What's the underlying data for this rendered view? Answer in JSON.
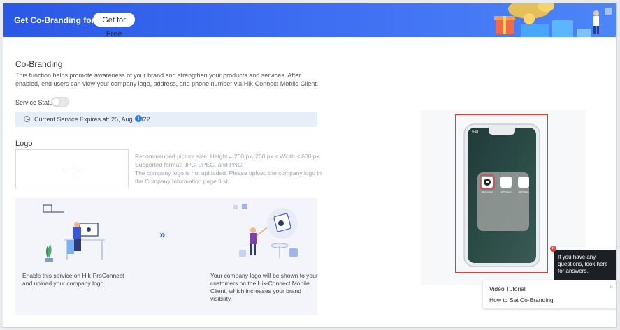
{
  "banner": {
    "title": "Get Co-Branding for Free",
    "button_label": "Get for Free"
  },
  "cobranding": {
    "title": "Co-Branding",
    "description": "This function helps promote awareness of your brand and strengthen your products and services. After enabled, end users can view your company logo, address, and phone number via Hik-Connect Mobile Client.",
    "service_status_label": "Service Status:",
    "service_enabled": false,
    "expire_text": "Current Service Expires at: 25, Aug. 2022"
  },
  "logo": {
    "title": "Logo",
    "hint_line1": "Recommended picture size: Height = 200 px, 200 px ≤ Width ≤ 600 px.",
    "hint_line2": "Supported format: JPG, JPEG, and PNG.",
    "hint_line3": "The company logo is not uploaded. Please upload the company logo in the Company Information page first."
  },
  "promo": {
    "left_text": "Enable this service on Hik-ProConnect and upload your company logo.",
    "right_text": "Your company logo will be shown to your customers on the Hik-Connect Mobile Client, which increases your brand visibility.",
    "arrows": "»"
  },
  "preview": {
    "app_labels": [
      "Hik-Connect",
      "APP Name",
      "APP Name"
    ]
  },
  "tooltip": {
    "text": "If you have any questions, look here for answers."
  },
  "video_card": {
    "title": "Video Tutorial",
    "link": "How to Set Co-Branding"
  },
  "colors": {
    "banner_blue": "#2a58e6",
    "accent_red": "#e23b3b",
    "info_blue": "#2f7de1",
    "promo_bg": "#f3f5fb"
  }
}
